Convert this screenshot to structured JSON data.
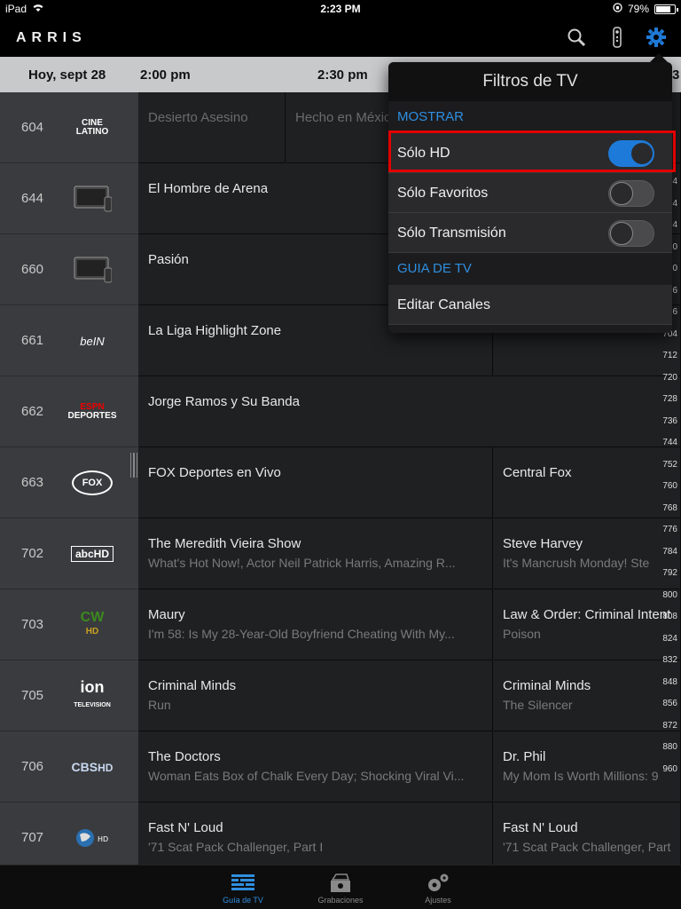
{
  "status": {
    "device": "iPad",
    "time": "2:23 PM",
    "battery": "79%",
    "battery_level": 0.79
  },
  "header": {
    "logo": "ARRIS"
  },
  "timebar": {
    "date": "Hoy, sept 28",
    "t1": "2:00 pm",
    "t2": "2:30 pm"
  },
  "channels": [
    {
      "num": "604",
      "logo": "CINE LATINO",
      "p1": {
        "t": "Desierto Asesino",
        "s": ""
      },
      "p1b": {
        "t": "Hecho en México",
        "s": ""
      },
      "p2": null
    },
    {
      "num": "644",
      "logo": "tv-placeholder",
      "p1": {
        "t": "El Hombre de Arena",
        "s": ""
      },
      "p2": null
    },
    {
      "num": "660",
      "logo": "tv-placeholder",
      "p1": {
        "t": "Pasión",
        "s": ""
      },
      "p2": null
    },
    {
      "num": "661",
      "logo": "beIN SPORTS",
      "p1": {
        "t": "La Liga Highlight Zone",
        "s": ""
      },
      "p2": {
        "t": "",
        "s": ""
      }
    },
    {
      "num": "662",
      "logo": "ESPN DEPORTES",
      "p1": {
        "t": "Jorge Ramos y Su Banda",
        "s": ""
      },
      "p2": null
    },
    {
      "num": "663",
      "logo": "FOX DEPORTES",
      "p1": {
        "t": "FOX Deportes en Vivo",
        "s": ""
      },
      "p2": {
        "t": "Central Fox",
        "s": ""
      }
    },
    {
      "num": "702",
      "logo": "abcHD",
      "p1": {
        "t": "The Meredith Vieira Show",
        "s": "What's Hot Now!, Actor Neil Patrick Harris, Amazing R..."
      },
      "p2": {
        "t": "Steve Harvey",
        "s": "It's Mancrush Monday! Ste"
      }
    },
    {
      "num": "703",
      "logo": "CW HD",
      "p1": {
        "t": "Maury",
        "s": "I'm 58: Is My 28-Year-Old Boyfriend Cheating With My..."
      },
      "p2": {
        "t": "Law & Order: Criminal Intent",
        "s": "Poison"
      }
    },
    {
      "num": "705",
      "logo": "ion TELEVISION",
      "p1": {
        "t": "Criminal Minds",
        "s": "Run"
      },
      "p2": {
        "t": "Criminal Minds",
        "s": "The Silencer"
      }
    },
    {
      "num": "706",
      "logo": "CBS HD",
      "p1": {
        "t": "The Doctors",
        "s": "Woman Eats Box of Chalk Every Day; Shocking Viral Vi..."
      },
      "p2": {
        "t": "Dr. Phil",
        "s": "My Mom Is Worth Millions: 9"
      }
    },
    {
      "num": "707",
      "logo": "Discovery HD",
      "p1": {
        "t": "Fast N' Loud",
        "s": "'71 Scat Pack Challenger, Part I"
      },
      "p2": {
        "t": "Fast N' Loud",
        "s": "'71 Scat Pack Challenger, Part"
      }
    }
  ],
  "index": [
    "4",
    "4",
    "4",
    "0",
    "0",
    "6",
    "6",
    "704",
    "712",
    "720",
    "728",
    "736",
    "744",
    "752",
    "760",
    "768",
    "776",
    "784",
    "792",
    "800",
    "808",
    "824",
    "832",
    "848",
    "856",
    "872",
    "880",
    "960"
  ],
  "popover": {
    "title": "Filtros de TV",
    "section1": "MOSTRAR",
    "rows": [
      {
        "label": "Sólo HD",
        "on": true
      },
      {
        "label": "Sólo Favoritos",
        "on": false
      },
      {
        "label": "Sólo Transmisión",
        "on": false
      }
    ],
    "section2": "GUIA DE TV",
    "edit": "Editar Canales"
  },
  "tabs": [
    {
      "label": "Guía de TV",
      "icon": "guide-icon",
      "active": true
    },
    {
      "label": "Grabaciones",
      "icon": "recordings-icon",
      "active": false
    },
    {
      "label": "Ajustes",
      "icon": "settings-icon",
      "active": false
    }
  ],
  "colors": {
    "accent": "#1e7ad8",
    "highlight": "#e10000"
  }
}
